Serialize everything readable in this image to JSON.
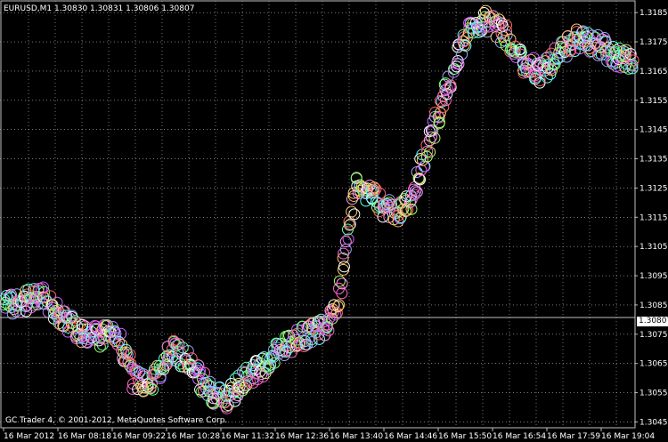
{
  "header": {
    "symbol_line": "EURUSD,M1  1.30830 1.30831 1.30806 1.30807"
  },
  "footer": {
    "copyright": "GC Trader 4, © 2001-2012, MetaQuotes Software Corp."
  },
  "price_scale": {
    "labels": [
      "1.31850",
      "1.31750",
      "1.31650",
      "1.31550",
      "1.31450",
      "1.31350",
      "1.31250",
      "1.31150",
      "1.31050",
      "1.30950",
      "1.30850",
      "1.30750",
      "1.30650",
      "1.30550",
      "1.30450"
    ],
    "current_price": "1.30807"
  },
  "time_scale": {
    "labels": [
      "16 Mar 2012",
      "16 Mar 08:18",
      "16 Mar 09:22",
      "16 Mar 10:28",
      "16 Mar 11:32",
      "16 Mar 12:36",
      "16 Mar 13:40",
      "16 Mar 14:46",
      "16 Mar 15:50",
      "16 Mar 16:54",
      "16 Mar 17:59",
      "16 Mar 19:04"
    ]
  },
  "colors": {
    "background": "#000000",
    "grid": "#c0c0c0",
    "text": "#ffffff",
    "price_line": "#c0c0c0",
    "marker_palette": [
      "#ff66cc",
      "#66ff99",
      "#99aaff",
      "#ffcc66",
      "#cc66ff",
      "#66ffff",
      "#ff6666",
      "#aaff66",
      "#ffffff",
      "#ff99ee"
    ]
  },
  "chart_data": {
    "type": "scatter",
    "marker": "circle",
    "ylim": [
      1.3043,
      1.3189
    ],
    "current_price": 1.30807,
    "series": [
      {
        "x": [
          "16 Mar 2012",
          "08:00",
          "08:18",
          "08:40",
          "09:00",
          "09:22",
          "09:50",
          "10:10",
          "10:28",
          "10:50",
          "11:10",
          "11:32",
          "11:50",
          "12:10",
          "12:36",
          "12:55",
          "13:15",
          "13:40",
          "13:50",
          "14:00",
          "14:10",
          "14:20",
          "14:30",
          "14:46",
          "15:00",
          "15:20",
          "15:50",
          "16:10",
          "16:30",
          "16:54",
          "17:20",
          "17:40",
          "17:59",
          "18:30",
          "19:04"
        ],
        "y": [
          1.3085,
          1.3086,
          1.3088,
          1.3082,
          1.3076,
          1.3074,
          1.3076,
          1.306,
          1.3058,
          1.307,
          1.3066,
          1.3056,
          1.3052,
          1.306,
          1.3064,
          1.307,
          1.3074,
          1.3076,
          1.3084,
          1.3126,
          1.3122,
          1.3116,
          1.312,
          1.3142,
          1.316,
          1.3178,
          1.3182,
          1.3178,
          1.3168,
          1.3164,
          1.3172,
          1.3176,
          1.3174,
          1.317,
          1.3168
        ]
      }
    ]
  }
}
